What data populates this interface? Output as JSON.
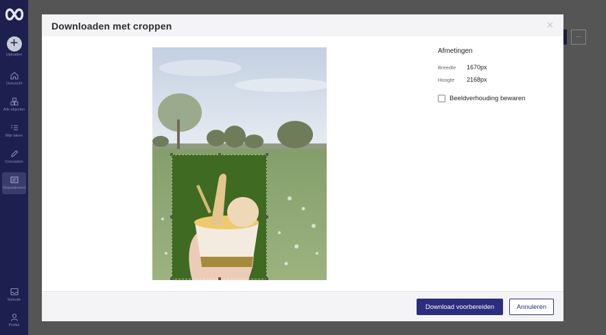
{
  "sidebar": {
    "items": [
      {
        "label": "Uploaden",
        "icon": "plus-icon"
      },
      {
        "label": "Overzicht",
        "icon": "home-icon"
      },
      {
        "label": "Alle objecten",
        "icon": "objects-icon"
      },
      {
        "label": "Mijn taken",
        "icon": "tasks-icon"
      },
      {
        "label": "Concepten",
        "icon": "pencil-icon"
      },
      {
        "label": "Gepubliceerd",
        "icon": "published-icon"
      },
      {
        "label": "Selectie",
        "icon": "inbox-icon"
      },
      {
        "label": "Profiel",
        "icon": "user-icon"
      }
    ]
  },
  "modal": {
    "title": "Downloaden met croppen",
    "close_icon": "close-icon",
    "dimensions": {
      "heading": "Afmetingen",
      "width_label": "Breedte",
      "width_value": "1670px",
      "height_label": "Hoogte",
      "height_value": "2168px"
    },
    "keep_ratio": {
      "label": "Beeldverhouding bewaren",
      "checked": false
    },
    "download_button": "Download voorbereiden",
    "cancel_button": "Annuleren"
  },
  "background": {
    "more_button": "···"
  },
  "colors": {
    "primary": "#2b2d7d",
    "sidebar": "#1d1f4e"
  }
}
